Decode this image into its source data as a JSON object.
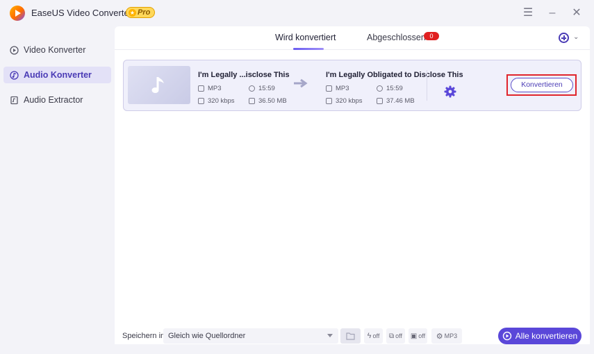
{
  "app": {
    "title": "EaseUS Video Converter",
    "pro_label": "Pro",
    "accent_color": "#5a47d9",
    "window_controls": [
      "menu-icon",
      "minimize-icon",
      "close-icon"
    ]
  },
  "sidebar": {
    "items": [
      {
        "label": "Video Konverter",
        "icon": "video-icon",
        "active": false
      },
      {
        "label": "Audio Konverter",
        "icon": "audio-icon",
        "active": true
      },
      {
        "label": "Audio Extractor",
        "icon": "extract-icon",
        "active": false
      }
    ]
  },
  "tabs": [
    {
      "label": "Wird konvertiert",
      "active": true
    },
    {
      "label": "Abgeschlossen",
      "active": false,
      "badge": "0"
    }
  ],
  "task": {
    "source": {
      "name": "I'm Legally ...isclose This",
      "format": "MP3",
      "duration": "15:59",
      "bitrate": "320 kbps",
      "size": "36.50 MB"
    },
    "target": {
      "name": "I'm Legally Obligated to Disclose This",
      "format": "MP3",
      "duration": "15:59",
      "bitrate": "320 kbps",
      "size": "37.46 MB"
    },
    "convert_label": "Konvertieren"
  },
  "bottom": {
    "save_label": "Speichern in:",
    "save_value": "Gleich wie Quellordner",
    "format_label": "MP3",
    "off_label": "off",
    "convert_all_label": "Alle konvertieren"
  }
}
